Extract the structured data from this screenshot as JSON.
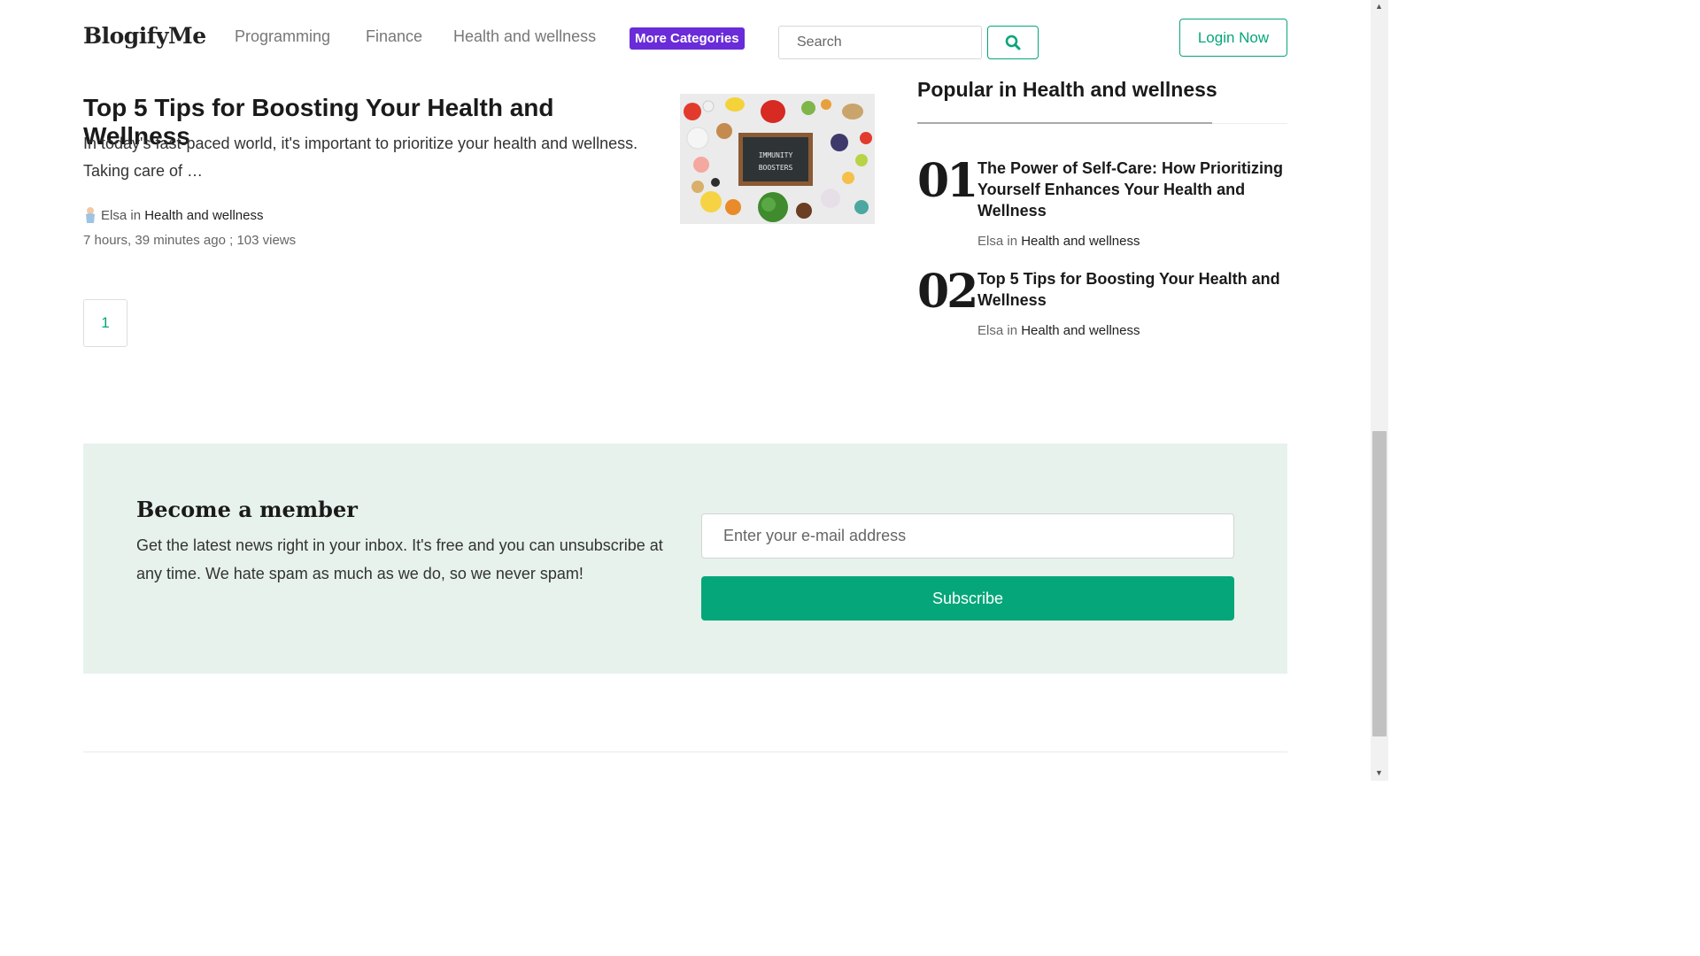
{
  "header": {
    "logo": "BlogifyMe",
    "nav": [
      "Programming",
      "Finance",
      "Health and wellness"
    ],
    "more_label": "More Categories",
    "search_placeholder": "Search",
    "login_label": "Login Now"
  },
  "article": {
    "title": "Top 5 Tips for Boosting Your Health and Wellness",
    "excerpt": "In today's fast-paced world, it's important to prioritize your health and wellness. Taking care of …",
    "image_text": [
      "IMMUNITY",
      "BOOSTERS"
    ],
    "author": "Elsa",
    "in_word": "in",
    "category": "Health and wellness",
    "meta": "7 hours, 39 minutes ago ; 103 views"
  },
  "pagination": {
    "current": "1"
  },
  "popular": {
    "title": "Popular in Health and wellness",
    "items": [
      {
        "num": "01",
        "title": "The Power of Self-Care: How Prioritizing Yourself Enhances Your Health and Wellness",
        "author": "Elsa",
        "in_word": "in",
        "category": "Health and wellness"
      },
      {
        "num": "02",
        "title": "Top 5 Tips for Boosting Your Health and Wellness",
        "author": "Elsa",
        "in_word": "in",
        "category": "Health and wellness"
      }
    ]
  },
  "newsletter": {
    "title": "Become a member",
    "text": "Get the latest news right in your inbox. It's free and you can unsubscribe at any time. We hate spam as much as we do, so we never spam!",
    "email_placeholder": "Enter your e-mail address",
    "subscribe_label": "Subscribe"
  },
  "colors": {
    "accent": "#05a67a",
    "more_categories": "#6a2bd9",
    "newsletter_bg": "#e7f2ec"
  },
  "icons": {
    "search": "search-icon"
  }
}
